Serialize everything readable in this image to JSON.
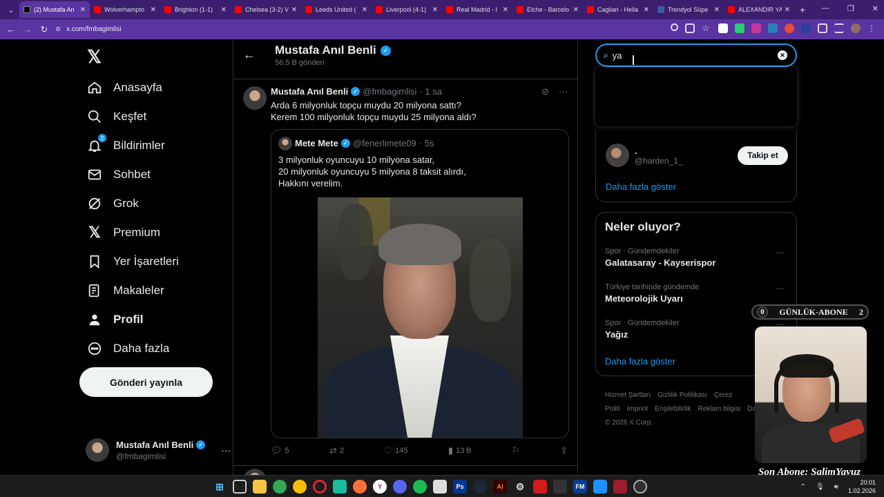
{
  "browser": {
    "tabs": [
      {
        "title": "(2) Mustafa An",
        "fav": "x",
        "active": true
      },
      {
        "title": "Wolverhampto",
        "fav": "yt"
      },
      {
        "title": "Brighton (1-1)",
        "fav": "yt"
      },
      {
        "title": "Chelsea (3-2) V",
        "fav": "yt"
      },
      {
        "title": "Leeds United (",
        "fav": "yt"
      },
      {
        "title": "Liverpool (4-1)",
        "fav": "yt"
      },
      {
        "title": "Real Madrid - I",
        "fav": "yt"
      },
      {
        "title": "Elche - Barcelo",
        "fav": "yt"
      },
      {
        "title": "Cagliari - Hella",
        "fav": "yt"
      },
      {
        "title": "Trendyol Süpe",
        "fav": "tr"
      },
      {
        "title": "ALEXANDIR YA",
        "fav": "yt"
      }
    ],
    "url": "x.com/fmbagimlisi",
    "accent_color": "#5a34a0"
  },
  "nav": {
    "items": [
      {
        "label": "Anasayfa",
        "icon": "home-icon"
      },
      {
        "label": "Keşfet",
        "icon": "search-icon"
      },
      {
        "label": "Bildirimler",
        "icon": "bell-icon",
        "badge": "2"
      },
      {
        "label": "Sohbet",
        "icon": "mail-icon"
      },
      {
        "label": "Grok",
        "icon": "grok-icon"
      },
      {
        "label": "Premium",
        "icon": "x-premium-icon"
      },
      {
        "label": "Yer İşaretleri",
        "icon": "bookmark-icon"
      },
      {
        "label": "Makaleler",
        "icon": "article-icon"
      },
      {
        "label": "Profil",
        "icon": "profile-icon"
      },
      {
        "label": "Daha fazla",
        "icon": "more-circle-icon"
      }
    ],
    "post_button": "Gönderi yayınla",
    "account": {
      "name": "Mustafa Anıl Benli",
      "handle": "@fmbagimlisi"
    }
  },
  "profile_header": {
    "name": "Mustafa Anıl Benli",
    "posts_count": "56,5 B gönderi"
  },
  "tweet": {
    "author": "Mustafa Anıl Benli",
    "handle": "@fmbagimlisi",
    "time": "· 1 sa",
    "line1": "Arda 6 milyonluk topçu muydu 20 milyona sattı?",
    "line2": "Kerem 100 milyonluk topçu muydu 25 milyona aldı?",
    "quote": {
      "author": "Mete Mete",
      "handle": "@fenerlimete09",
      "time": "· 5s",
      "line1": "3 milyonluk oyuncuyu 10 milyona satar,",
      "line2": "20 milyonluk oyuncuyu 5 milyona 8 taksit alırdı,",
      "line3": "Hakkını verelim."
    },
    "stats": {
      "replies": "5",
      "reposts": "2",
      "likes": "145",
      "views": "13 B"
    }
  },
  "search": {
    "value": "ya"
  },
  "who_to_follow": {
    "user": {
      "name": ".",
      "handle": "@harden_1_"
    },
    "follow_label": "Takip et",
    "show_more": "Daha fazla göster"
  },
  "trends": {
    "title": "Neler oluyor?",
    "items": [
      {
        "context": "Spor · Gündemdekiler",
        "topic": "Galatasaray - Kayserispor"
      },
      {
        "context": "Türkiye tarihinde gündemde",
        "topic": "Meteorolojik Uyarı"
      },
      {
        "context": "Spor · Gündemdekiler",
        "topic": "Yağız"
      }
    ],
    "show_more": "Daha fazla göster"
  },
  "footer": {
    "links": [
      "Hizmet Şartları",
      "Gizlilik Politikası",
      "Çerez Politi",
      "Imprint",
      "Erişilebilirlik",
      "Reklam bilgisi",
      "Daha"
    ],
    "copyright": "© 2026 X Corp."
  },
  "overlay": {
    "counter_left": "0",
    "counter_label": "GÜNLÜK-ABONE",
    "counter_right": "2",
    "signature": "Son Abone: SalimYavuz"
  },
  "taskbar": {
    "time": "20:01",
    "date": "1.02.2026"
  }
}
